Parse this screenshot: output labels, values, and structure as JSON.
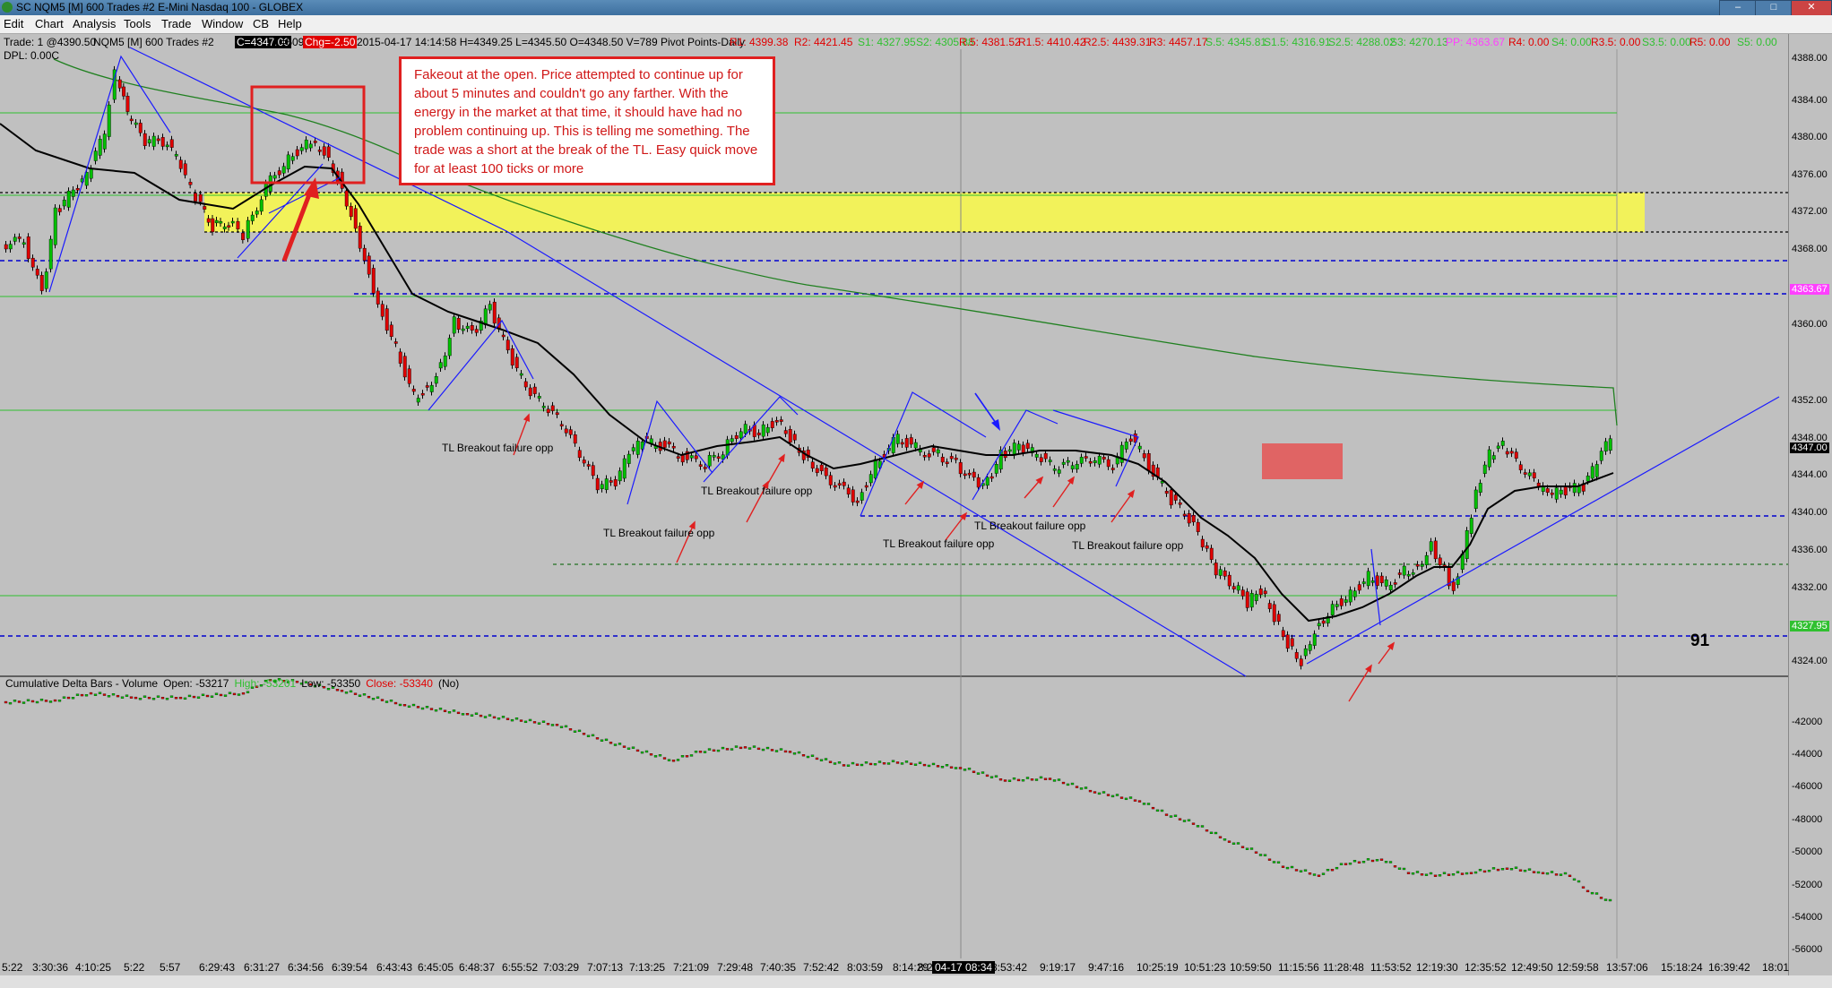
{
  "window": {
    "title": "SC NQM5 [M]  600 Trades  #2  E-Mini Nasdaq 100 - GLOBEX"
  },
  "menu": [
    "Edit",
    "Chart",
    "Analysis",
    "Tools",
    "Trade",
    "Window",
    "CB",
    "Help"
  ],
  "infobar": {
    "trade": "Trade: 1 @4390.50",
    "symbol": "NQM5 [M]  600 Trades  #2",
    "close_chip": "C=4347.00",
    "ticks": "T=509",
    "chg_chip": "Chg=-2.50",
    "bar_info": "2015-04-17 14:14:58  H=4349.25  L=4345.50  O=4348.50  V=789  Pivot Points-Daily",
    "r1": "R1: 4399.38",
    "r2": "R2: 4421.45",
    "s1": "S1: 4327.95",
    "s2": "S2: 4305.88",
    "r05": "R.5: 4381.52",
    "r15": "R1.5: 4410.42",
    "r25": "R2.5: 4439.31",
    "r3": "R3: 4457.17",
    "s05": "S.5: 4345.81",
    "s15": "S1.5: 4316.91",
    "s25": "S2.5: 4288.02",
    "s3": "S3: 4270.13",
    "pp": "PP: 4363.67",
    "r4": "R4: 0.00",
    "s4": "S4: 0.00",
    "r35": "R3.5: 0.00",
    "s35": "S3.5: 0.00",
    "r5": "R5: 0.00",
    "s5": "S5: 0.00",
    "dpl": "DPL: 0.00C"
  },
  "colors": {
    "background": "#c0c0c0",
    "up_candle": "#00c000",
    "down_candle": "#e00000",
    "trendline": "#1a1aff",
    "annotation": "#e02020",
    "zone": "#f2f25a",
    "pp_label": "#ff40ff",
    "s_label": "#30c030"
  },
  "annotation": {
    "text": "Fakeout at the open.  Price attempted to continue up for about 5 minutes and couldn't go any farther.   With the energy in the market at that time, it should have had no problem continuing up.  This is telling me something.  The trade was a short at the break of the TL.  Easy quick move for at least 100 ticks or more"
  },
  "labels": {
    "tl1": "TL Breakout failure opp",
    "tl2": "TL Breakout failure opp",
    "tl3": "TL Breakout failure opp",
    "tl4": "TL Breakout failure opp",
    "tl5": "TL Breakout failure opp",
    "tl6": "TL Breakout failure opp",
    "big_number": "91"
  },
  "price_axis": {
    "ticks": [
      "4384.00",
      "4380.00",
      "4376.00",
      "4372.00",
      "4368.00",
      "4360.00",
      "4352.00",
      "4348.00",
      "4344.00",
      "4340.00",
      "4336.00",
      "4332.00",
      "4324.00"
    ],
    "top_tick": "4388.00",
    "current": "4347.00",
    "pp_box": "4363.67",
    "s1_box": "4327.95"
  },
  "lower_panel": {
    "title": "Cumulative Delta Bars - Volume",
    "open": "Open: -53217",
    "high": "High: -53201",
    "low": "Low: -53350",
    "close": "Close: -53340",
    "flag": "(No)",
    "ticks": [
      "-42000",
      "-44000",
      "-46000",
      "-48000",
      "-50000",
      "-52000",
      "-54000",
      "-56000"
    ]
  },
  "time_axis": [
    "5:22",
    "3:30:36",
    "4:10:25",
    "5:22",
    "5:57",
    "6:29:43",
    "6:31:27",
    "6:34:56",
    "6:39:54",
    "6:43:43",
    "6:45:05",
    "6:48:37",
    "6:55:52",
    "7:03:29",
    "7:07:13",
    "7:13:25",
    "7:21:09",
    "7:29:48",
    "7:40:35",
    "7:52:42",
    "8:03:59",
    "8:14:29",
    "8:2",
    "04-17  08:34",
    "8:53:42",
    "9:19:17",
    "9:47:16",
    "10:25:19",
    "10:51:23",
    "10:59:50",
    "11:15:56",
    "11:28:48",
    "11:53:52",
    "12:19:30",
    "12:35:52",
    "12:49:50",
    "12:59:58",
    "13:57:06",
    "15:18:24",
    "16:39:42",
    "18:01"
  ]
}
